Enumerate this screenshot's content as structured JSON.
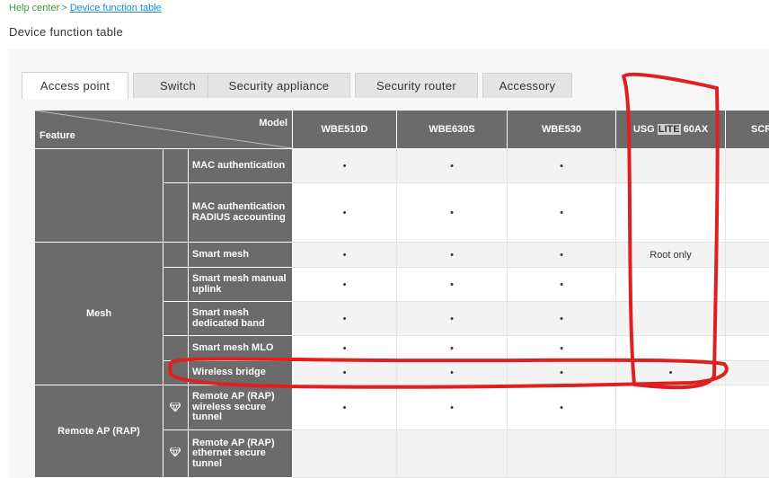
{
  "breadcrumb": {
    "home": "Help center",
    "separator": ">",
    "current": "Device function table"
  },
  "page_title": "Device function table",
  "tabs": [
    {
      "label": "Access point",
      "active": true
    },
    {
      "label": "Switch",
      "active": false
    },
    {
      "label": "Security appliance",
      "active": false
    },
    {
      "label": "Security router",
      "active": false
    },
    {
      "label": "Accessory",
      "active": false
    }
  ],
  "table": {
    "corner": {
      "model_label": "Model",
      "feature_label": "Feature"
    },
    "models": [
      "WBE510D",
      "WBE630S",
      "WBE530",
      "USG LITE 60AX",
      "SCR"
    ],
    "highlighted_text": "LITE",
    "groups": [
      "",
      "Mesh",
      "Remote AP (RAP)"
    ],
    "rows": [
      {
        "feature": "MAC authentication",
        "values": [
          "•",
          "•",
          "•",
          "",
          ""
        ]
      },
      {
        "feature": "MAC authentication RADIUS accounting",
        "values": [
          "•",
          "•",
          "•",
          "",
          ""
        ]
      },
      {
        "feature": "Smart mesh",
        "values": [
          "•",
          "•",
          "•",
          "Root only",
          ""
        ]
      },
      {
        "feature": "Smart mesh manual uplink",
        "values": [
          "•",
          "•",
          "•",
          "",
          ""
        ]
      },
      {
        "feature": "Smart mesh dedicated band",
        "values": [
          "•",
          "•",
          "•",
          "",
          ""
        ]
      },
      {
        "feature": "Smart mesh MLO",
        "values": [
          "•",
          "•",
          "•",
          "",
          ""
        ]
      },
      {
        "feature": "Wireless bridge",
        "values": [
          "•",
          "•",
          "•",
          "•",
          ""
        ]
      },
      {
        "feature": "Remote AP (RAP) wireless secure tunnel",
        "values": [
          "•",
          "•",
          "•",
          "",
          ""
        ],
        "icon": "diamond-icon"
      },
      {
        "feature": "Remote AP (RAP) ethernet secure tunnel",
        "values": [
          "",
          "",
          "",
          "",
          ""
        ],
        "icon": "diamond-icon"
      }
    ]
  },
  "annotation": {
    "color": "#e02020"
  }
}
